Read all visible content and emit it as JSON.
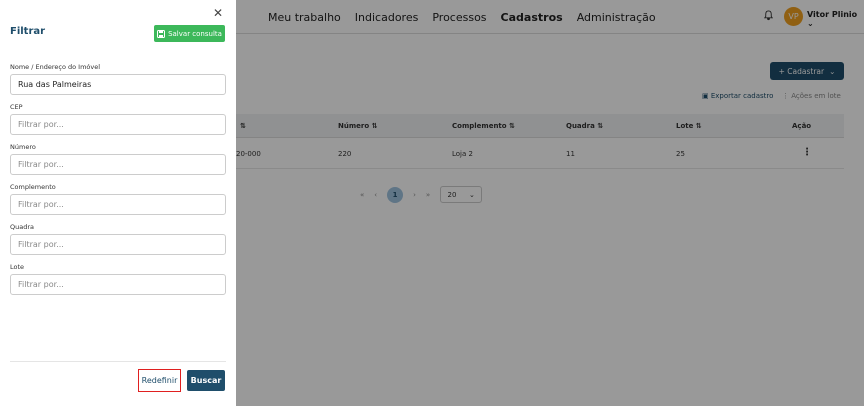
{
  "nav": {
    "items": [
      "Meu trabalho",
      "Indicadores",
      "Processos",
      "Cadastros",
      "Administração"
    ],
    "active": "Cadastros"
  },
  "user": {
    "initials": "VP",
    "name": "Vitor Plinio ⌄"
  },
  "icons": {
    "bell": "bell-icon",
    "close": "close-icon",
    "save": "floppy-icon",
    "kebab": "kebab-icon"
  },
  "actions": {
    "cadastrar": "+ Cadastrar",
    "cadastrar_chevron": "⌄",
    "exportar": "Exportar cadastro",
    "acoes_lote": "Ações em lote"
  },
  "table": {
    "headers": [
      "⇅",
      "Número ⇅",
      "Complemento ⇅",
      "Quadra ⇅",
      "Lote ⇅",
      "Ação"
    ],
    "row": [
      "20-000",
      "220",
      "Loja 2",
      "11",
      "25"
    ],
    "action_glyph": "⋮"
  },
  "pagination": {
    "first": "«",
    "prev": "‹",
    "current": "1",
    "next": "›",
    "last": "»",
    "page_size": "20",
    "page_size_chevron": "⌄"
  },
  "filter": {
    "title": "Filtrar",
    "save_label": "Salvar consulta",
    "fields": [
      {
        "label": "Nome / Endereço do Imóvel",
        "value": "Rua das Palmeiras",
        "placeholder": ""
      },
      {
        "label": "CEP",
        "value": "",
        "placeholder": "Filtrar por..."
      },
      {
        "label": "Número",
        "value": "",
        "placeholder": "Filtrar por..."
      },
      {
        "label": "Complemento",
        "value": "",
        "placeholder": "Filtrar por..."
      },
      {
        "label": "Quadra",
        "value": "",
        "placeholder": "Filtrar por..."
      },
      {
        "label": "Lote",
        "value": "",
        "placeholder": "Filtrar por..."
      }
    ],
    "reset_label": "Redefinir",
    "search_label": "Buscar"
  },
  "colors": {
    "primary": "#1f4e6b",
    "success": "#3cb85a",
    "highlight": "#e02020",
    "avatar": "#f0a020"
  }
}
